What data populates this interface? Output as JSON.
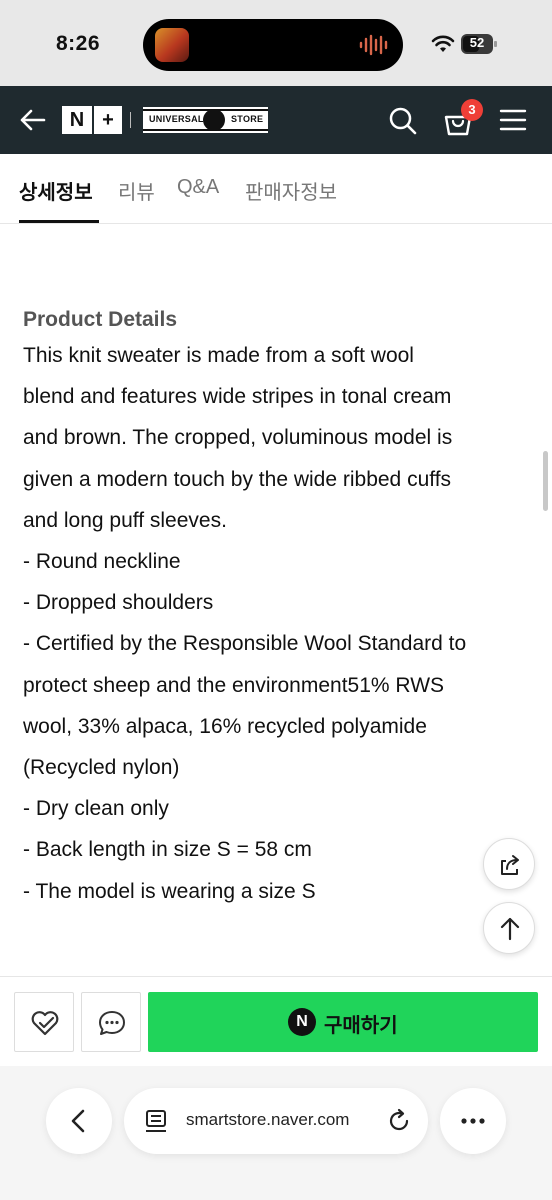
{
  "status_bar": {
    "time": "8:26",
    "battery": "52"
  },
  "header": {
    "np_logo_n": "N",
    "np_logo_plus": "+",
    "store_logo_left": "UNIVERSAL",
    "store_logo_right": "STORE",
    "cart_count": "3"
  },
  "tabs": [
    {
      "label": "상세정보",
      "active": true
    },
    {
      "label": "리뷰",
      "active": false
    },
    {
      "label": "Q&A",
      "active": false
    },
    {
      "label": "판매자정보",
      "active": false
    }
  ],
  "content": {
    "title": "Product Details",
    "lines": [
      "This knit sweater is made from a soft wool",
      "blend and features wide stripes in tonal cream",
      "and brown. The cropped, voluminous model is",
      "given a modern touch by the wide ribbed cuffs",
      "and long puff sleeves.",
      "- Round neckline",
      "- Dropped shoulders",
      "- Certified by the Responsible Wool Standard to",
      "protect sheep and the environment51% RWS",
      "wool, 33% alpaca, 16% recycled polyamide",
      "(Recycled nylon)",
      "- Dry clean only",
      "- Back length in size S = 58 cm",
      "- The model is wearing a size S"
    ]
  },
  "purchase_bar": {
    "buy_icon": "N",
    "buy_label": "구매하기"
  },
  "browser": {
    "url": "smartstore.naver.com"
  },
  "colors": {
    "header_bg": "#1f2a2f",
    "buy_green": "#20d45a",
    "badge_red": "#ef3f37"
  }
}
